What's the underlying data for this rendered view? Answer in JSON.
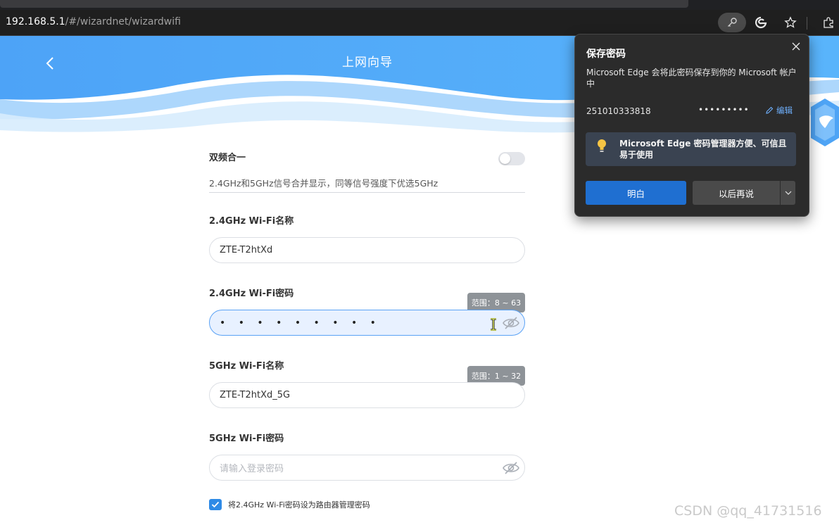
{
  "browser": {
    "url_host": "192.168.5.1",
    "url_path": "/#/wizardnet/wizardwifi"
  },
  "header": {
    "title": "上网向导"
  },
  "form": {
    "dual_band": {
      "label": "双频合一",
      "enabled": false,
      "description": "2.4GHz和5GHz信号合并显示，同等信号强度下优选5GHz"
    },
    "wifi24_name": {
      "label": "2.4GHz Wi-Fi名称",
      "value": "ZTE-T2htXd"
    },
    "wifi24_password": {
      "label": "2.4GHz Wi-Fi密码",
      "value": "• • • • • • • • •",
      "tooltip": "范围：8 ~ 63"
    },
    "wifi5_name": {
      "label": "5GHz Wi-Fi名称",
      "value": "ZTE-T2htXd_5G",
      "tooltip": "范围：1 ~ 32"
    },
    "wifi5_password": {
      "label": "5GHz Wi-Fi密码",
      "placeholder": "请输入登录密码"
    },
    "use_as_admin": {
      "label": "将2.4GHz Wi-Fi密码设为路由器管理密码",
      "checked": true
    }
  },
  "save_password_popup": {
    "title": "保存密码",
    "description": "Microsoft Edge 会将此密码保存到你的 Microsoft 帐户中",
    "username": "251010333818",
    "password_mask": "•••••••••",
    "edit_label": "编辑",
    "info_text": "Microsoft Edge 密码管理器方便、可信且易于使用",
    "primary_button": "明白",
    "secondary_button": "以后再说"
  },
  "watermark": "CSDN @qq_41731516",
  "colors": {
    "accent_blue": "#3f9bf6",
    "edge_button": "#1f6fd1",
    "checkbox": "#2e8ae6"
  }
}
